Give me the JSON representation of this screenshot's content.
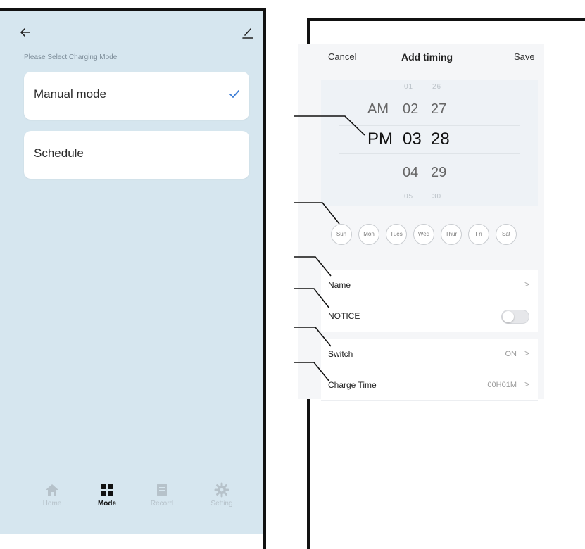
{
  "left_screen": {
    "caption": "Please Select Charging Mode",
    "modes": [
      {
        "label": "Manual mode",
        "selected": true
      },
      {
        "label": "Schedule",
        "selected": false
      }
    ],
    "tabs": [
      {
        "label": "Home",
        "icon": "home-icon",
        "active": false
      },
      {
        "label": "Mode",
        "icon": "grid-icon",
        "active": true
      },
      {
        "label": "Record",
        "icon": "record-icon",
        "active": false
      },
      {
        "label": "Setting",
        "icon": "gear-icon",
        "active": false
      }
    ]
  },
  "right_screen": {
    "nav": {
      "cancel": "Cancel",
      "title": "Add timing",
      "save": "Save"
    },
    "picker": {
      "top_small": {
        "hour": "01",
        "minute": "26"
      },
      "above": {
        "ampm": "AM",
        "hour": "02",
        "minute": "27"
      },
      "selected": {
        "ampm": "PM",
        "hour": "03",
        "minute": "28"
      },
      "below": {
        "hour": "04",
        "minute": "29"
      },
      "bottom_small": {
        "hour": "05",
        "minute": "30"
      }
    },
    "days": [
      "Sun",
      "Mon",
      "Tues",
      "Wed",
      "Thur",
      "Fri",
      "Sat"
    ],
    "rows": {
      "name": {
        "label": "Name",
        "chevron": ">"
      },
      "notice": {
        "label": "NOTICE",
        "enabled": false
      },
      "switch": {
        "label": "Switch",
        "value": "ON",
        "chevron": ">"
      },
      "charge_time": {
        "label": "Charge Time",
        "value": "00H01M",
        "chevron": ">"
      }
    }
  },
  "colors": {
    "left_bg": "#d6e6ef",
    "check": "#3a7bd5",
    "right_bg": "#f5f6f8"
  }
}
